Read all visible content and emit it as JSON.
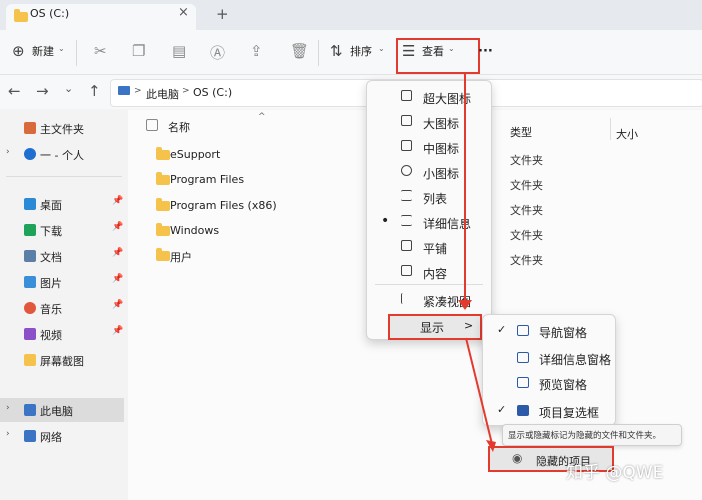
{
  "window": {
    "tab_title": "OS (C:)",
    "tab_close": "×",
    "new_tab": "+"
  },
  "toolbar": {
    "new_label": "新建",
    "sort_label": "排序",
    "view_label": "查看",
    "more_label": "···"
  },
  "address": {
    "breadcrumb_1": "此电脑",
    "breadcrumb_sep": ">",
    "breadcrumb_2": "OS (C:)",
    "breadcrumb_chev": ">"
  },
  "sidebar": {
    "items": [
      {
        "label": "主文件夹",
        "icon": "home-icon"
      },
      {
        "label": "一 - 个人",
        "icon": "cloud-icon"
      },
      {
        "label": "桌面",
        "icon": "desktop-icon"
      },
      {
        "label": "下载",
        "icon": "download-icon"
      },
      {
        "label": "文档",
        "icon": "document-icon"
      },
      {
        "label": "图片",
        "icon": "picture-icon"
      },
      {
        "label": "音乐",
        "icon": "music-icon"
      },
      {
        "label": "视频",
        "icon": "video-icon"
      },
      {
        "label": "屏幕截图",
        "icon": "folder-icon"
      },
      {
        "label": "此电脑",
        "icon": "pc-icon"
      },
      {
        "label": "网络",
        "icon": "network-icon"
      }
    ]
  },
  "content": {
    "col_name": "名称",
    "col_type": "类型",
    "col_size": "大小",
    "rows": [
      {
        "name": "eSupport",
        "type": "文件夹"
      },
      {
        "name": "Program Files",
        "type": "文件夹"
      },
      {
        "name": "Program Files (x86)",
        "type": "文件夹"
      },
      {
        "name": "Windows",
        "type": "文件夹"
      },
      {
        "name": "用户",
        "type": "文件夹"
      }
    ]
  },
  "view_menu": {
    "items": [
      "超大图标",
      "大图标",
      "中图标",
      "小图标",
      "列表",
      "详细信息",
      "平铺",
      "内容",
      "紧凑视图"
    ],
    "show_label": "显示",
    "show_arrow": ">",
    "selected_bullet": "•"
  },
  "show_submenu": {
    "items": [
      "导航窗格",
      "详细信息窗格",
      "预览窗格",
      "项目复选框"
    ],
    "tooltip": "显示或隐藏标记为隐藏的文件和文件夹。",
    "hidden_items": "隐藏的项目",
    "check": "✓"
  },
  "watermark": "知乎 @QWE",
  "colors": {
    "highlight": "#e23b2e",
    "folder": "#f5c34b",
    "accent": "#2b5aa8"
  }
}
